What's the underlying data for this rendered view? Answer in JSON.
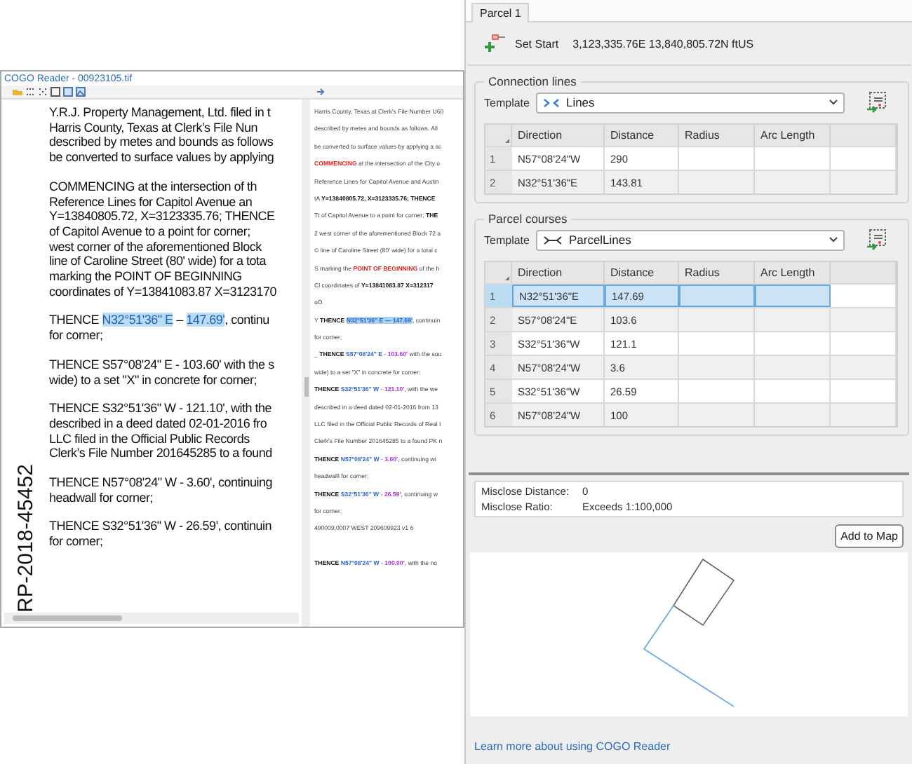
{
  "document_window": {
    "title": "COGO Reader - 00923105.tif",
    "scan": {
      "side_label": "RP-2018-45452",
      "paragraphs": [
        [
          "Y.R.J. Property Management, Ltd. filed in t",
          "Harris County, Texas at Clerk’s File Nun",
          "described by metes and bounds as follows",
          "be converted to surface values by applying"
        ],
        [
          "COMMENCING at the intersection of th",
          "Reference Lines for Capitol Avenue an",
          "Y=13840805.72, X=3123335.76; THENCE",
          "of Capitol Avenue to a point for corner;",
          "west corner of the aforementioned Block",
          "line of Caroline Street (80' wide) for a tota",
          "marking the POINT OF BEGINNING",
          "coordinates of Y=13841083.87 X=3123170"
        ],
        [
          {
            "segments": [
              {
                "kind": "plain",
                "text": "THENCE "
              },
              {
                "kind": "hl",
                "text": "N32°51'36\" E"
              },
              {
                "kind": "plain",
                "text": " – "
              },
              {
                "kind": "hl",
                "text": "147.69'"
              },
              {
                "kind": "plain",
                "text": ", continu"
              }
            ]
          },
          "for corner;"
        ],
        [
          "THENCE S57°08'24\" E - 103.60' with the s",
          "wide) to a set \"X\" in concrete for corner;"
        ],
        [
          "THENCE S32°51'36\" W - 121.10', with the",
          "described in a deed dated 02-01-2016 fro",
          "LLC  filed in the Official Public Records",
          "Clerk’s File Number 201645285 to a found"
        ],
        [
          "THENCE N57°08'24\" W - 3.60', continuing",
          "headwall for corner;"
        ],
        [
          "THENCE S32°51'36\" W - 26.59', continuin",
          "for corner;"
        ]
      ]
    },
    "ocr_text": {
      "lines": [
        [
          {
            "kind": "plain",
            "text": "Harris County, Texas at Clerk's File Number U60"
          }
        ],
        [
          {
            "kind": "plain",
            "text": "described by metes and bounds as follows. All"
          }
        ],
        [
          {
            "kind": "plain",
            "text": "be converted to surface values by applying a sc"
          }
        ],
        [
          {
            "kind": "red",
            "text": "COMMENCING"
          },
          {
            "kind": "plain",
            "text": " at the intersection of the City o"
          }
        ],
        [
          {
            "kind": "plain",
            "text": "Reference Lines for Capitol Avenue and Austin"
          }
        ],
        [
          {
            "kind": "plain",
            "text": "tA "
          },
          {
            "kind": "bold",
            "text": "Y=13840805.72, X=3123335.76; THENCE"
          }
        ],
        [
          {
            "kind": "plain",
            "text": "Tt of Capitol Avenue to a point for corner; "
          },
          {
            "kind": "bold",
            "text": "THE"
          }
        ],
        [
          {
            "kind": "plain",
            "text": "2 west corner of the aforementioned Block 72 a"
          }
        ],
        [
          {
            "kind": "plain",
            "text": "© line of Caroline Street (80' wide) for a total c"
          }
        ],
        [
          {
            "kind": "plain",
            "text": "S marking the "
          },
          {
            "kind": "red",
            "text": "POINT OF BEGINNING"
          },
          {
            "kind": "plain",
            "text": " of the h"
          }
        ],
        [
          {
            "kind": "plain",
            "text": "Cl coordinates of "
          },
          {
            "kind": "bold",
            "text": "Y=13841083.87 X=312317"
          }
        ],
        [
          {
            "kind": "plain",
            "text": "oO"
          }
        ],
        [
          {
            "kind": "plain",
            "text": "Y "
          },
          {
            "kind": "bold",
            "text": "THENCE "
          },
          {
            "kind": "hl",
            "text": "N32°51'36\" E — 147.69'"
          },
          {
            "kind": "plain",
            "text": ", continuin"
          }
        ],
        [
          {
            "kind": "plain",
            "text": "for corner;"
          }
        ],
        [
          {
            "kind": "plain",
            "text": "_ "
          },
          {
            "kind": "bold",
            "text": "THENCE "
          },
          {
            "kind": "blue",
            "text": "S57°08'24\" E"
          },
          {
            "kind": "plain",
            "text": " - "
          },
          {
            "kind": "purple",
            "text": "103.60'"
          },
          {
            "kind": "plain",
            "text": " with the sou"
          }
        ],
        [
          {
            "kind": "plain",
            "text": "wide) to a set \"X\" in concrete for corner;"
          }
        ],
        [
          {
            "kind": "bold",
            "text": "THENCE "
          },
          {
            "kind": "blue",
            "text": "S32°51'36\" W"
          },
          {
            "kind": "plain",
            "text": " - "
          },
          {
            "kind": "purple",
            "text": "121.10'"
          },
          {
            "kind": "plain",
            "text": ", with the we"
          }
        ],
        [
          {
            "kind": "plain",
            "text": "described in a deed dated 02-01-2016 from 13"
          }
        ],
        [
          {
            "kind": "plain",
            "text": "LLC filed in the Official Public Records of Real I"
          }
        ],
        [
          {
            "kind": "plain",
            "text": "Clerk's File Number 201645285 to a found PK n"
          }
        ],
        [
          {
            "kind": "bold",
            "text": "THENCE "
          },
          {
            "kind": "blue",
            "text": "N57°08'24\" W"
          },
          {
            "kind": "plain",
            "text": " - "
          },
          {
            "kind": "purple",
            "text": "3.60'"
          },
          {
            "kind": "plain",
            "text": ", continuing wi"
          }
        ],
        [
          {
            "kind": "plain",
            "text": "headwalll for corner;"
          }
        ],
        [
          {
            "kind": "bold",
            "text": "THENCE "
          },
          {
            "kind": "blue",
            "text": "S32°51'36\" W"
          },
          {
            "kind": "plain",
            "text": " - "
          },
          {
            "kind": "purple",
            "text": "26.59'"
          },
          {
            "kind": "plain",
            "text": ", continuing w"
          }
        ],
        [
          {
            "kind": "plain",
            "text": "for corner;"
          }
        ],
        [
          {
            "kind": "plain",
            "text": "490009,0007 WEST 209609923 v1 6"
          }
        ],
        [
          {
            "kind": "bold",
            "text": "THENCE "
          },
          {
            "kind": "blue",
            "text": "N57°08'24\" W"
          },
          {
            "kind": "plain",
            "text": " - "
          },
          {
            "kind": "purple",
            "text": "100.00'"
          },
          {
            "kind": "plain",
            "text": ", with the no"
          }
        ]
      ]
    }
  },
  "parcel_panel": {
    "tabs": [
      {
        "label": "Parcel 1",
        "selected": true
      }
    ],
    "set_start": {
      "label": "Set Start",
      "coordinates": "3,123,335.76E 13,840,805.72N ftUS"
    },
    "connection_lines": {
      "title": "Connection lines",
      "template_label": "Template",
      "template_value": "Lines",
      "columns": [
        "Direction",
        "Distance",
        "Radius",
        "Arc Length"
      ],
      "rows": [
        {
          "number": "1",
          "direction": "N57°08'24\"W",
          "distance": "290",
          "selected": false
        },
        {
          "number": "2",
          "direction": "N32°51'36\"E",
          "distance": "143.81",
          "selected": false
        }
      ]
    },
    "parcel_courses": {
      "title": "Parcel courses",
      "template_label": "Template",
      "template_value": "ParcelLines",
      "columns": [
        "Direction",
        "Distance",
        "Radius",
        "Arc Length"
      ],
      "rows": [
        {
          "number": "1",
          "direction": "N32°51'36\"E",
          "distance": "147.69",
          "selected": true
        },
        {
          "number": "2",
          "direction": "S57°08'24\"E",
          "distance": "103.6",
          "selected": false
        },
        {
          "number": "3",
          "direction": "S32°51'36\"W",
          "distance": "121.1",
          "selected": false
        },
        {
          "number": "4",
          "direction": "N57°08'24\"W",
          "distance": "3.6",
          "selected": false
        },
        {
          "number": "5",
          "direction": "S32°51'36\"W",
          "distance": "26.59",
          "selected": false
        },
        {
          "number": "6",
          "direction": "N57°08'24\"W",
          "distance": "100",
          "selected": false
        }
      ]
    },
    "misclose": [
      {
        "label": "Misclose Distance:",
        "value": "0"
      },
      {
        "label": "Misclose Ratio:",
        "value": "Exceeds 1:100,000"
      }
    ],
    "add_button": "Add to Map",
    "help_link": "Learn more about using COGO Reader"
  }
}
